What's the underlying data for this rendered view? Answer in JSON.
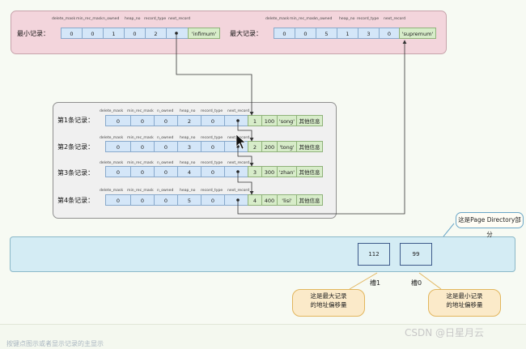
{
  "min_record": {
    "label": "最小记录：",
    "headers": [
      "delete_mask",
      "min_rec_mask",
      "n_owned",
      "heap_no",
      "record_type",
      "next_record"
    ],
    "values": [
      "0",
      "0",
      "1",
      "0",
      "2",
      ""
    ],
    "data_label": "'infimum'"
  },
  "max_record": {
    "label": "最大记录：",
    "headers": [
      "delete_mask",
      "min_rec_mask",
      "n_owned",
      "heap_no",
      "record_type",
      "next_record"
    ],
    "values": [
      "0",
      "0",
      "5",
      "1",
      "3",
      "0"
    ],
    "data_label": "'supremum'"
  },
  "records": [
    {
      "label": "第1条记录：",
      "headers": [
        "delete_mask",
        "min_rec_mask",
        "n_owned",
        "heap_no",
        "record_type",
        "next_record"
      ],
      "values": [
        "0",
        "0",
        "0",
        "2",
        "0",
        ""
      ],
      "data": [
        "1",
        "100",
        "'song'",
        "其他信息"
      ]
    },
    {
      "label": "第2条记录：",
      "headers": [
        "delete_mask",
        "min_rec_mask",
        "n_owned",
        "heap_no",
        "record_type",
        "next_record"
      ],
      "values": [
        "0",
        "0",
        "0",
        "3",
        "0",
        ""
      ],
      "data": [
        "2",
        "200",
        "'tong'",
        "其他信息"
      ]
    },
    {
      "label": "第3条记录：",
      "headers": [
        "delete_mask",
        "min_rec_mask",
        "n_owned",
        "heap_no",
        "record_type",
        "next_record"
      ],
      "values": [
        "0",
        "0",
        "0",
        "4",
        "0",
        ""
      ],
      "data": [
        "3",
        "300",
        "'zhan'",
        "其他信息"
      ]
    },
    {
      "label": "第4条记录：",
      "headers": [
        "delete_mask",
        "min_rec_mask",
        "n_owned",
        "heap_no",
        "record_type",
        "next_record"
      ],
      "values": [
        "0",
        "0",
        "0",
        "5",
        "0",
        ""
      ],
      "data": [
        "4",
        "400",
        "'lisi'",
        "其他信息"
      ]
    }
  ],
  "page_directory": {
    "callout": "这是Page Directory部分",
    "slots": [
      {
        "value": "112",
        "label": "槽1",
        "note": "这是最大记录\n的地址偏移量"
      },
      {
        "value": "99",
        "label": "槽0",
        "note": "这是最小记录\n的地址偏移量"
      }
    ]
  },
  "watermark": "CSDN @日星月云",
  "bottom_text": "按键点图示或者显示记录的主显示"
}
